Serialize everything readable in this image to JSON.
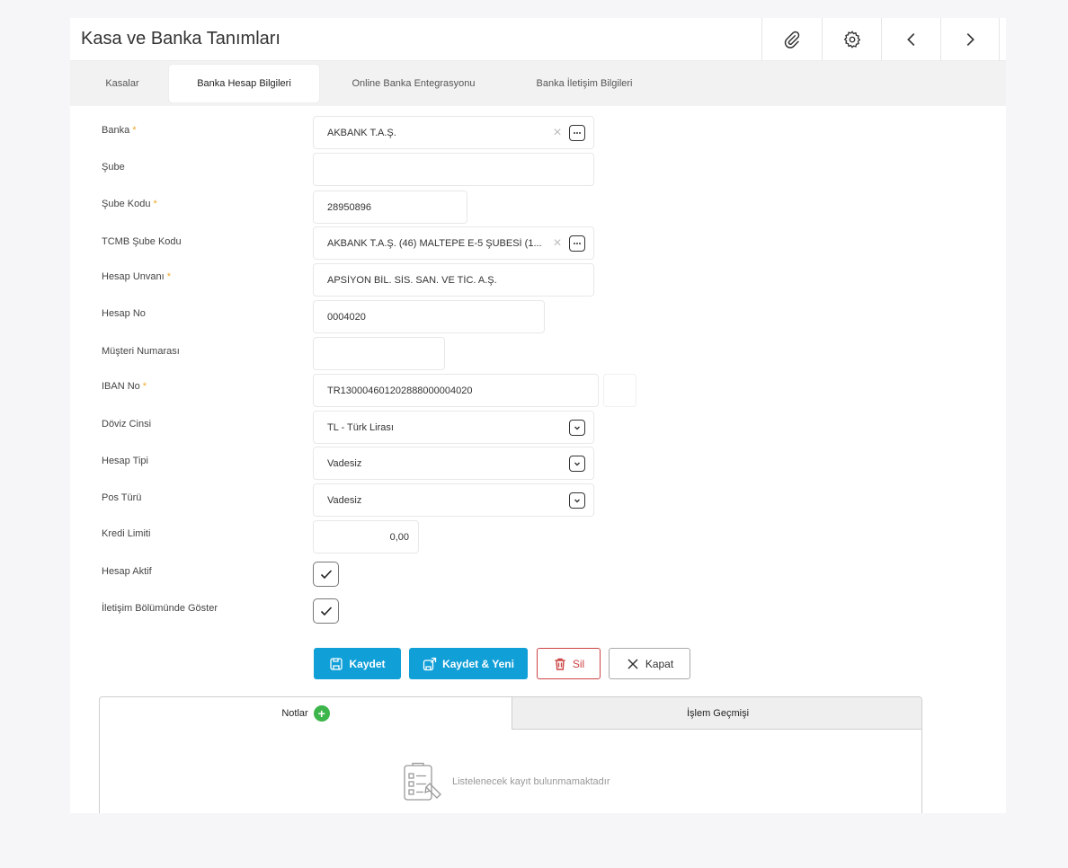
{
  "window": {
    "title": "Kasa ve Banka Tanımları"
  },
  "toolbar": {
    "icons": [
      "paperclip-icon",
      "gear-icon",
      "chevron-left-icon",
      "chevron-right-icon"
    ]
  },
  "tabs": [
    {
      "label": "Kasalar",
      "active": false
    },
    {
      "label": "Banka Hesap Bilgileri",
      "active": true
    },
    {
      "label": "Online Banka Entegrasyonu",
      "active": false
    },
    {
      "label": "Banka İletişim Bilgileri",
      "active": false
    }
  ],
  "form": {
    "required_mark": "*",
    "banka": {
      "label": "Banka",
      "value": "AKBANK T.A.Ş."
    },
    "sube": {
      "label": "Şube",
      "value": ""
    },
    "sube_kodu": {
      "label": "Şube Kodu",
      "value": "28950896"
    },
    "tcmb_sube_kodu": {
      "label": "TCMB Şube Kodu",
      "value": "AKBANK T.A.Ş. (46) MALTEPE E-5 ŞUBESİ (1..."
    },
    "hesap_unvani": {
      "label": "Hesap Unvanı",
      "value": "APSİYON BİL. SİS. SAN. VE TİC. A.Ş."
    },
    "hesap_no": {
      "label": "Hesap No",
      "value": "0004020"
    },
    "musteri_numarasi": {
      "label": "Müşteri Numarası",
      "value": ""
    },
    "iban_no": {
      "label": "IBAN No",
      "value": "TR130004601202888000004020"
    },
    "doviz_cinsi": {
      "label": "Döviz Cinsi",
      "value": "TL - Türk Lirası"
    },
    "hesap_tipi": {
      "label": "Hesap Tipi",
      "value": "Vadesiz"
    },
    "pos_turu": {
      "label": "Pos Türü",
      "value": "Vadesiz"
    },
    "kredi_limiti": {
      "label": "Kredi Limiti",
      "value": "0,00"
    },
    "hesap_aktif": {
      "label": "Hesap Aktif",
      "checked": true
    },
    "iletisim_goster": {
      "label": "İletişim Bölümünde Göster",
      "checked": true
    }
  },
  "actions": {
    "save": "Kaydet",
    "save_new": "Kaydet & Yeni",
    "delete": "Sil",
    "close": "Kapat"
  },
  "bottom_tabs": {
    "notes": "Notlar",
    "history": "İşlem Geçmişi",
    "empty_message": "Listelenecek kayıt bulunmamaktadır"
  },
  "colors": {
    "primary": "#119fd8",
    "danger": "#cc4444",
    "required": "#f0a82a",
    "add": "#3cb54a"
  }
}
